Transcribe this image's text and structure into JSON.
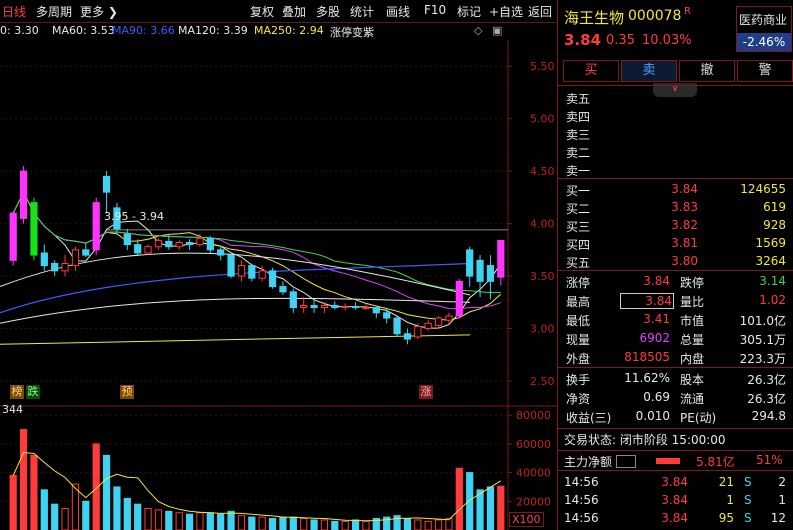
{
  "toolbar": {
    "items_left": [
      "日线",
      "多周期",
      "更多 ❯"
    ],
    "items_right": [
      "复权",
      "叠加",
      "多股",
      "统计",
      "画线",
      "F10",
      "标记",
      "+自选",
      "返回"
    ]
  },
  "ma_line": {
    "items": [
      {
        "text": "0: 3.30",
        "color": "#e8e8e8"
      },
      {
        "text": "MA60: 3.53",
        "color": "#e8e8e8"
      },
      {
        "text": "MA90: 3.66",
        "color": "#3a5cff"
      },
      {
        "text": "MA120: 3.39",
        "color": "#e8e8e8"
      },
      {
        "text": "MA250: 2.94",
        "color": "#f2e83a"
      },
      {
        "text": "涨停变紫",
        "color": "#e8e8e8"
      }
    ]
  },
  "price_axis": [
    "5.50",
    "5.00",
    "4.50",
    "4.00",
    "3.50",
    "3.00",
    "2.50"
  ],
  "volume_axis": [
    "80000",
    "60000",
    "40000",
    "20000"
  ],
  "volume_unit": "X100",
  "chart_annotations": {
    "range_label": "3.95 - 3.94",
    "volume_label": "344",
    "markers": [
      "榜",
      "跌",
      "预",
      "涨"
    ]
  },
  "quote": {
    "name": "海王生物",
    "code": "000078",
    "flag": "R",
    "sector": "医药商业",
    "sector_change": "-2.46%",
    "price": "3.84",
    "change": "0.35",
    "change_pct": "10.03%",
    "buttons": [
      "买",
      "卖",
      "撤",
      "警"
    ]
  },
  "order_book": {
    "sells": [
      {
        "label": "卖五",
        "price": "",
        "vol": ""
      },
      {
        "label": "卖四",
        "price": "",
        "vol": ""
      },
      {
        "label": "卖三",
        "price": "",
        "vol": ""
      },
      {
        "label": "卖二",
        "price": "",
        "vol": ""
      },
      {
        "label": "卖一",
        "price": "",
        "vol": ""
      }
    ],
    "buys": [
      {
        "label": "买一",
        "price": "3.84",
        "vol": "124655"
      },
      {
        "label": "买二",
        "price": "3.83",
        "vol": "619"
      },
      {
        "label": "买三",
        "price": "3.82",
        "vol": "928"
      },
      {
        "label": "买四",
        "price": "3.81",
        "vol": "1569"
      },
      {
        "label": "买五",
        "price": "3.80",
        "vol": "3264"
      }
    ]
  },
  "stats": [
    {
      "l1": "涨停",
      "v1": "3.84",
      "c1": "red",
      "l2": "跌停",
      "v2": "3.14",
      "c2": "green"
    },
    {
      "l1": "最高",
      "v1": "3.84",
      "c1": "red",
      "l2": "量比",
      "v2": "1.02",
      "c2": "red"
    },
    {
      "l1": "最低",
      "v1": "3.41",
      "c1": "red",
      "l2": "市值",
      "v2": "101.0亿",
      "c2": "white"
    },
    {
      "l1": "现量",
      "v1": "6902",
      "c1": "magenta",
      "l2": "总量",
      "v2": "305.1万",
      "c2": "white"
    },
    {
      "l1": "外盘",
      "v1": "818505",
      "c1": "red",
      "l2": "内盘",
      "v2": "223.3万",
      "c2": "white"
    }
  ],
  "stats2": [
    {
      "l1": "换手",
      "v1": "11.62%",
      "c1": "white",
      "l2": "股本",
      "v2": "26.3亿",
      "c2": "white"
    },
    {
      "l1": "净资",
      "v1": "0.69",
      "c1": "white",
      "l2": "流通",
      "v2": "26.3亿",
      "c2": "white"
    },
    {
      "l1": "收益(三)",
      "v1": "0.010",
      "c1": "white",
      "l2": "PE(动)",
      "v2": "294.8",
      "c2": "white"
    }
  ],
  "trade_status": "交易状态: 闭市阶段 15:00:00",
  "main_flow": {
    "label": "主力净额",
    "value": "5.81亿",
    "pct": "51%"
  },
  "ticks": [
    {
      "time": "14:56",
      "price": "3.84",
      "vol": "21",
      "side": "S",
      "n": "2"
    },
    {
      "time": "14:56",
      "price": "3.84",
      "vol": "1",
      "side": "S",
      "n": "1"
    },
    {
      "time": "14:56",
      "price": "3.84",
      "vol": "95",
      "side": "S",
      "n": "12"
    }
  ],
  "chart_data": {
    "type": "candlestick",
    "price_range": [
      2.3,
      5.75
    ],
    "candles": [
      {
        "o": 3.65,
        "c": 4.1,
        "h": 4.12,
        "l": 3.6,
        "up": true,
        "limit": true
      },
      {
        "o": 4.05,
        "c": 4.5,
        "h": 4.55,
        "l": 4.0,
        "up": true,
        "limit": true
      },
      {
        "o": 4.2,
        "c": 3.7,
        "h": 4.25,
        "l": 3.65,
        "up": false,
        "limit": true
      },
      {
        "o": 3.72,
        "c": 3.6,
        "h": 3.8,
        "l": 3.55,
        "up": false
      },
      {
        "o": 3.62,
        "c": 3.55,
        "h": 3.65,
        "l": 3.5,
        "up": false
      },
      {
        "o": 3.55,
        "c": 3.62,
        "h": 3.7,
        "l": 3.5,
        "up": true
      },
      {
        "o": 3.6,
        "c": 3.75,
        "h": 3.78,
        "l": 3.55,
        "up": true
      },
      {
        "o": 3.75,
        "c": 3.7,
        "h": 3.82,
        "l": 3.68,
        "up": false
      },
      {
        "o": 3.75,
        "c": 4.2,
        "h": 4.25,
        "l": 3.7,
        "up": true,
        "limit": true
      },
      {
        "o": 4.3,
        "c": 4.45,
        "h": 4.5,
        "l": 4.1,
        "up": false
      },
      {
        "o": 4.15,
        "c": 3.95,
        "h": 4.2,
        "l": 3.9,
        "up": false
      },
      {
        "o": 3.9,
        "c": 3.8,
        "h": 3.95,
        "l": 3.75,
        "up": false
      },
      {
        "o": 3.8,
        "c": 3.72,
        "h": 3.85,
        "l": 3.7,
        "up": false
      },
      {
        "o": 3.72,
        "c": 3.78,
        "h": 3.8,
        "l": 3.7,
        "up": true
      },
      {
        "o": 3.78,
        "c": 3.84,
        "h": 3.86,
        "l": 3.75,
        "up": true
      },
      {
        "o": 3.83,
        "c": 3.78,
        "h": 3.9,
        "l": 3.75,
        "up": false
      },
      {
        "o": 3.78,
        "c": 3.82,
        "h": 3.84,
        "l": 3.75,
        "up": true
      },
      {
        "o": 3.82,
        "c": 3.8,
        "h": 3.85,
        "l": 3.75,
        "up": false
      },
      {
        "o": 3.8,
        "c": 3.86,
        "h": 3.9,
        "l": 3.78,
        "up": true
      },
      {
        "o": 3.86,
        "c": 3.75,
        "h": 3.88,
        "l": 3.72,
        "up": false
      },
      {
        "o": 3.75,
        "c": 3.7,
        "h": 3.78,
        "l": 3.65,
        "up": false
      },
      {
        "o": 3.7,
        "c": 3.5,
        "h": 3.72,
        "l": 3.48,
        "up": false
      },
      {
        "o": 3.5,
        "c": 3.6,
        "h": 3.65,
        "l": 3.45,
        "up": true
      },
      {
        "o": 3.6,
        "c": 3.48,
        "h": 3.62,
        "l": 3.45,
        "up": false
      },
      {
        "o": 3.48,
        "c": 3.55,
        "h": 3.6,
        "l": 3.45,
        "up": true
      },
      {
        "o": 3.55,
        "c": 3.4,
        "h": 3.58,
        "l": 3.38,
        "up": false
      },
      {
        "o": 3.4,
        "c": 3.35,
        "h": 3.45,
        "l": 3.32,
        "up": false
      },
      {
        "o": 3.35,
        "c": 3.2,
        "h": 3.38,
        "l": 3.15,
        "up": false
      },
      {
        "o": 3.2,
        "c": 3.22,
        "h": 3.3,
        "l": 3.15,
        "up": true
      },
      {
        "o": 3.22,
        "c": 3.2,
        "h": 3.28,
        "l": 3.15,
        "up": false
      },
      {
        "o": 3.2,
        "c": 3.22,
        "h": 3.25,
        "l": 3.15,
        "up": true
      },
      {
        "o": 3.22,
        "c": 3.2,
        "h": 3.26,
        "l": 3.18,
        "up": false
      },
      {
        "o": 3.2,
        "c": 3.21,
        "h": 3.24,
        "l": 3.17,
        "up": true
      },
      {
        "o": 3.21,
        "c": 3.2,
        "h": 3.25,
        "l": 3.18,
        "up": false
      },
      {
        "o": 3.2,
        "c": 3.2,
        "h": 3.23,
        "l": 3.18,
        "up": true
      },
      {
        "o": 3.2,
        "c": 3.15,
        "h": 3.22,
        "l": 3.1,
        "up": false
      },
      {
        "o": 3.15,
        "c": 3.1,
        "h": 3.2,
        "l": 3.05,
        "up": false
      },
      {
        "o": 3.1,
        "c": 2.95,
        "h": 3.12,
        "l": 2.92,
        "up": false
      },
      {
        "o": 2.95,
        "c": 2.9,
        "h": 3.0,
        "l": 2.85,
        "up": false
      },
      {
        "o": 2.92,
        "c": 3.02,
        "h": 3.05,
        "l": 2.9,
        "up": true
      },
      {
        "o": 3.0,
        "c": 3.05,
        "h": 3.08,
        "l": 2.98,
        "up": true
      },
      {
        "o": 3.03,
        "c": 3.1,
        "h": 3.12,
        "l": 3.0,
        "up": true
      },
      {
        "o": 3.08,
        "c": 3.12,
        "h": 3.15,
        "l": 3.05,
        "up": true
      },
      {
        "o": 3.12,
        "c": 3.45,
        "h": 3.47,
        "l": 3.1,
        "up": true,
        "limit": true
      },
      {
        "o": 3.5,
        "c": 3.75,
        "h": 3.78,
        "l": 3.4,
        "up": false
      },
      {
        "o": 3.65,
        "c": 3.45,
        "h": 3.7,
        "l": 3.3,
        "up": false
      },
      {
        "o": 3.45,
        "c": 3.6,
        "h": 3.7,
        "l": 3.28,
        "up": false
      },
      {
        "o": 3.49,
        "c": 3.84,
        "h": 3.84,
        "l": 3.41,
        "up": true,
        "limit": true
      }
    ],
    "volumes": [
      38000,
      70000,
      52000,
      28000,
      18000,
      15000,
      32000,
      20000,
      60000,
      52000,
      30000,
      22000,
      18000,
      15000,
      14000,
      13000,
      12000,
      11000,
      12000,
      12000,
      11000,
      13000,
      10000,
      9000,
      9000,
      8000,
      9000,
      9000,
      8000,
      7000,
      7000,
      6000,
      6000,
      7000,
      6000,
      8000,
      9000,
      10000,
      8000,
      7000,
      6000,
      7000,
      8000,
      43000,
      40000,
      28000,
      30000,
      30500
    ],
    "volume_range": [
      0,
      85000
    ]
  }
}
